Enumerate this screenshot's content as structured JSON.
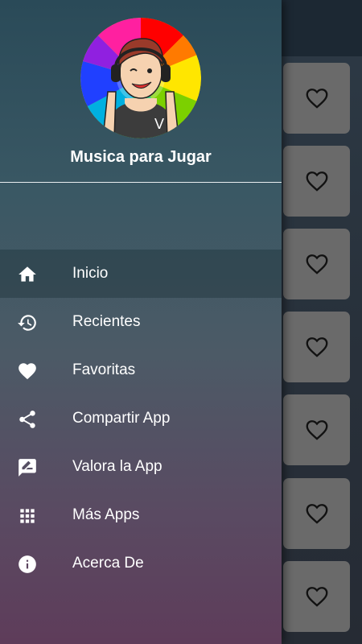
{
  "drawer": {
    "app_name": "Musica para Jugar",
    "avatar_badge": "V",
    "menu": [
      {
        "label": "Inicio",
        "icon": "home-icon",
        "active": true
      },
      {
        "label": "Recientes",
        "icon": "history-icon",
        "active": false
      },
      {
        "label": "Favoritas",
        "icon": "heart-icon",
        "active": false
      },
      {
        "label": "Compartir App",
        "icon": "share-icon",
        "active": false
      },
      {
        "label": "Valora la App",
        "icon": "rate-review-icon",
        "active": false
      },
      {
        "label": "Más Apps",
        "icon": "apps-grid-icon",
        "active": false
      },
      {
        "label": "Acerca De",
        "icon": "info-icon",
        "active": false
      }
    ]
  },
  "background_list": {
    "card_count": 7,
    "card_icon": "heart-outline-icon",
    "card_color": "#6a6a6a"
  },
  "colors": {
    "drawer_top": "#2a4a58",
    "drawer_bottom": "#5e3c5a",
    "text": "#ffffff"
  }
}
